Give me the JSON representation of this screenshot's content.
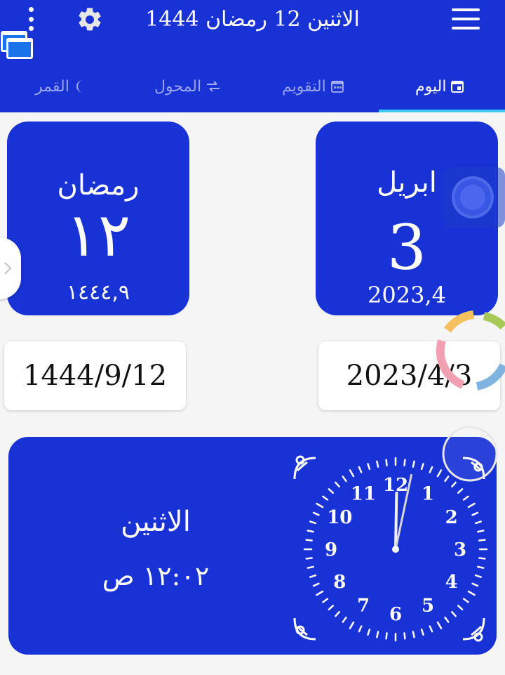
{
  "header": {
    "title": "الاثنين 12 رمضان 1444",
    "menu_icon": "hamburger-menu-icon",
    "settings_icon": "gear-icon",
    "more_icon": "more-vertical-icon",
    "window_icon": "floating-window-icon"
  },
  "tabs": [
    {
      "label": "اليوم",
      "icon": "calendar-day-icon",
      "active": true
    },
    {
      "label": "التقويم",
      "icon": "calendar-icon",
      "active": false
    },
    {
      "label": "المحول",
      "icon": "swap-icon",
      "active": false
    },
    {
      "label": "القمر",
      "icon": "crescent-moon-icon",
      "active": false
    }
  ],
  "hijri_card": {
    "month": "رمضان",
    "day": "١٢",
    "year_line": "١٤٤٤,٩"
  },
  "gregorian_card": {
    "month": "ابريل",
    "day": "3",
    "year_line": "2023,4"
  },
  "hijri_date": "1444/9/12",
  "gregorian_date": "2023/4/3",
  "clock": {
    "day_name": "الاثنين",
    "time": "١٢:٠٢ ص",
    "hour": 12,
    "minute": 2,
    "numerals": [
      "12",
      "1",
      "2",
      "3",
      "4",
      "5",
      "6",
      "7",
      "8",
      "9",
      "10",
      "11"
    ]
  },
  "colors": {
    "primary": "#1832d6",
    "accent": "#3cc8f0",
    "background": "#f5f5f5"
  }
}
